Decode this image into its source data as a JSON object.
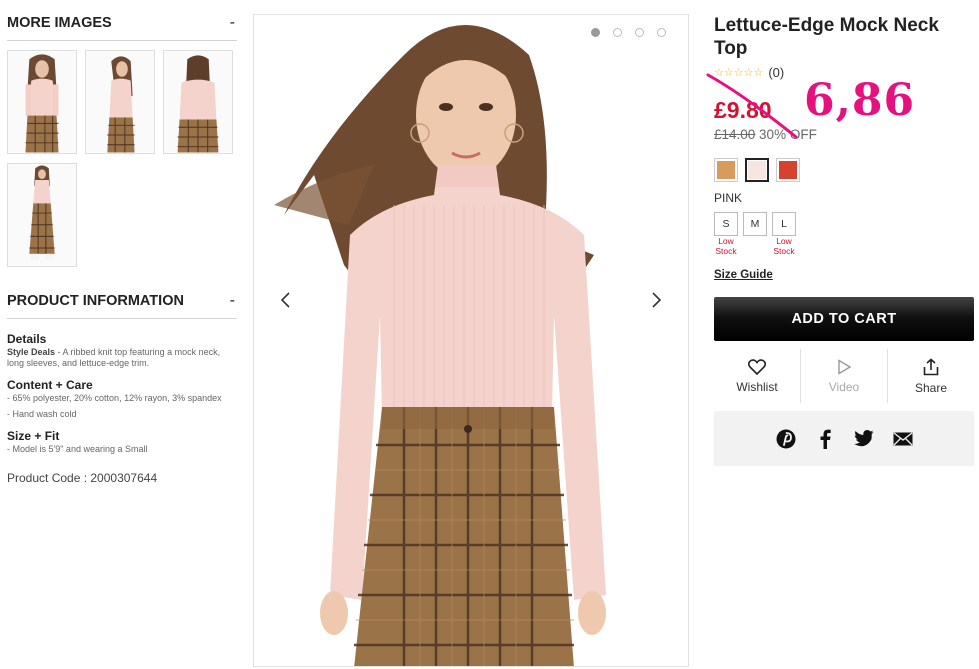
{
  "more_images": {
    "title": "MORE IMAGES",
    "toggle": "-"
  },
  "product_info": {
    "title": "PRODUCT INFORMATION",
    "toggle": "-",
    "details_title": "Details",
    "details_brand": "Style Deals",
    "details_text": " - A ribbed knit top featuring a mock neck, long sleeves, and lettuce-edge trim.",
    "content_title": "Content + Care",
    "content_line1": "- 65% polyester, 20% cotton, 12% rayon, 3% spandex",
    "content_line2": "- Hand wash cold",
    "size_title": "Size + Fit",
    "size_line1": "- Model is 5'9\" and wearing a Small",
    "product_code": "Product Code : 2000307644"
  },
  "product": {
    "title": "Lettuce-Edge Mock Neck Top",
    "stars": "☆☆☆☆☆",
    "rating_count": "(0)",
    "sale_price": "£9.80",
    "handwritten_price": "6,86",
    "original_price": "£14.00",
    "discount": " 30% OFF",
    "color_name": "PINK",
    "swatches": [
      {
        "name": "tan",
        "color": "#d99a5e",
        "selected": false
      },
      {
        "name": "pink",
        "color": "#f6e6df",
        "selected": true
      },
      {
        "name": "red",
        "color": "#d5432f",
        "selected": false
      }
    ],
    "sizes": [
      {
        "label": "S",
        "note_line1": "Low",
        "note_line2": "Stock"
      },
      {
        "label": "M",
        "note_line1": "",
        "note_line2": ""
      },
      {
        "label": "L",
        "note_line1": "Low",
        "note_line2": "Stock"
      }
    ],
    "size_guide": "Size Guide",
    "add_to_cart": "ADD TO CART",
    "actions": {
      "wishlist": "Wishlist",
      "video": "Video",
      "share": "Share"
    },
    "social_icons": [
      "pinterest-icon",
      "facebook-icon",
      "twitter-icon",
      "email-icon"
    ]
  },
  "gallery": {
    "dot_count": 4,
    "active_dot": 1
  },
  "colors": {
    "sale_red": "#d11234",
    "handwritten_pink": "#e5117f",
    "top_pink": "#f4d3cc",
    "plaid_brown": "#9b7349"
  }
}
